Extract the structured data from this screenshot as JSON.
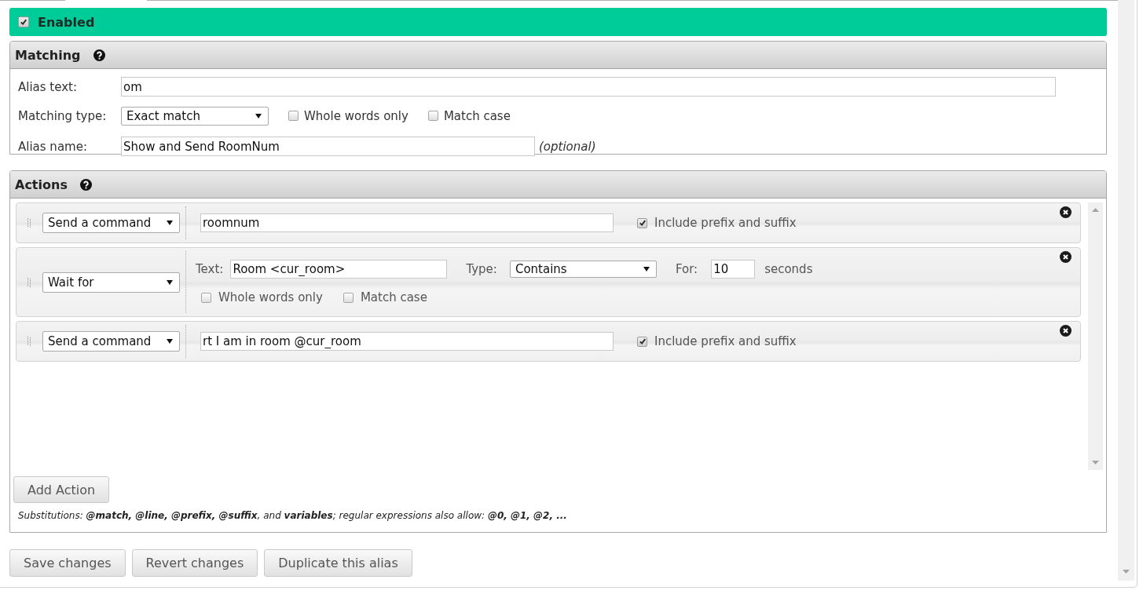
{
  "enabled": {
    "label": "Enabled",
    "checked": true
  },
  "matching": {
    "title": "Matching",
    "alias_text": {
      "label": "Alias text:",
      "value": "om"
    },
    "matching_type": {
      "label": "Matching type:",
      "value": "Exact match",
      "options": [
        {
          "label": "Whole words only",
          "checked": false
        },
        {
          "label": "Match case",
          "checked": false
        }
      ]
    },
    "alias_name": {
      "label": "Alias name:",
      "value": "Show and Send RoomNum",
      "note": "(optional)"
    }
  },
  "actions": {
    "title": "Actions",
    "items": [
      {
        "kind": "command",
        "type": "Send a command",
        "value": "roomnum",
        "option": {
          "label": "Include prefix and suffix",
          "checked": true
        }
      },
      {
        "kind": "wait",
        "type": "Wait for",
        "text_label": "Text:",
        "text_value": "Room <cur_room>",
        "match_label": "Type:",
        "match_value": "Contains",
        "timeout_label": "For:",
        "timeout_value": "10",
        "timeout_unit": "seconds",
        "options": [
          {
            "label": "Whole words only",
            "checked": false
          },
          {
            "label": "Match case",
            "checked": false
          }
        ]
      },
      {
        "kind": "command",
        "type": "Send a command",
        "value": "rt I am in room @cur_room",
        "option": {
          "label": "Include prefix and suffix",
          "checked": true
        }
      }
    ],
    "add_button": "Add Action",
    "note": "Substitutions: **@match, @line, @prefix, @suffix**, and **variables**; regular expressions also allow: **@0, @1, @2, ...**"
  },
  "buttons": [
    "Save changes",
    "Revert changes",
    "Duplicate this alias"
  ]
}
